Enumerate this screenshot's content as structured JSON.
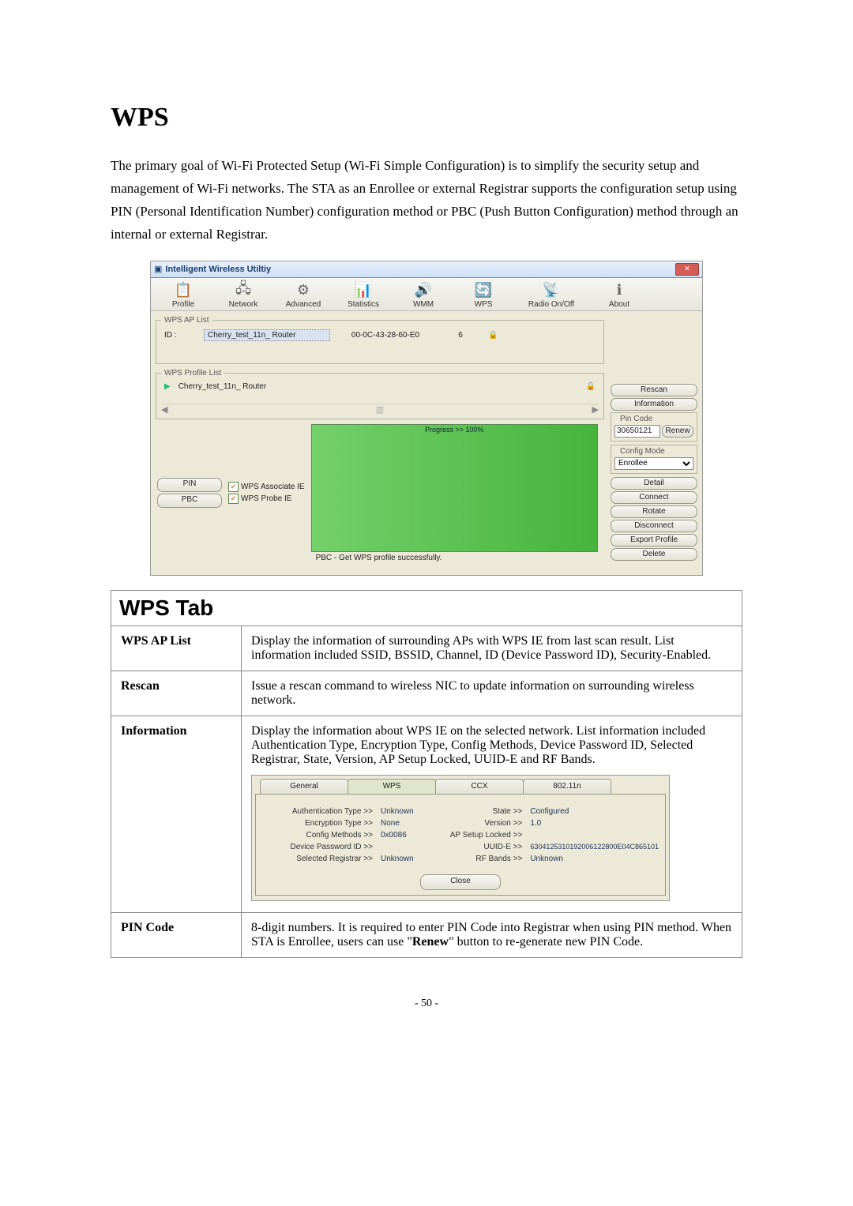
{
  "heading": "WPS",
  "intro": "The primary goal of Wi-Fi Protected Setup (Wi-Fi Simple Configuration) is to simplify the security setup and management of Wi-Fi networks. The STA as an Enrollee or external Registrar supports the configuration setup using PIN (Personal Identification Number) configuration method or PBC (Push Button Configuration) method through an internal or external Registrar.",
  "page_number": "- 50 -",
  "shot1": {
    "title": "Intelligent Wireless Utiltiy",
    "toolbar": {
      "profile": "Profile",
      "network": "Network",
      "advanced": "Advanced",
      "statistics": "Statistics",
      "wmm": "WMM",
      "wps": "WPS",
      "radio": "Radio On/Off",
      "about": "About"
    },
    "ap_list": {
      "legend": "WPS AP List",
      "id_label": "ID :",
      "ssid": "Cherry_test_11n_ Router",
      "bssid": "00-0C-43-28-60-E0",
      "channel": "6"
    },
    "profile_list": {
      "legend": "WPS Profile List",
      "item": "Cherry_test_11n_ Router"
    },
    "side": {
      "rescan": "Rescan",
      "information": "Information",
      "pin_code_label": "Pin Code",
      "pin_code_value": "30650121",
      "renew": "Renew",
      "config_mode_label": "Config Mode",
      "config_mode_value": "Enrollee",
      "detail": "Detail",
      "connect": "Connect",
      "rotate": "Rotate",
      "disconnect": "Disconnect",
      "export_profile": "Export Profile",
      "delete": "Delete"
    },
    "bottom": {
      "pin": "PIN",
      "pbc": "PBC",
      "wps_assoc": "WPS Associate IE",
      "wps_probe": "WPS Probe IE",
      "progress": "Progress >> 100%",
      "status": "PBC - Get WPS profile successfully."
    }
  },
  "table": {
    "title": "WPS Tab",
    "rows": [
      {
        "label": "WPS AP List",
        "text": "Display the information of surrounding APs with WPS IE from last scan result. List information included SSID, BSSID, Channel, ID (Device Password ID), Security-Enabled."
      },
      {
        "label": "Rescan",
        "text": "Issue a rescan command to wireless NIC to update information on surrounding wireless network."
      },
      {
        "label": "Information",
        "text": "Display the information about WPS IE on the selected network. List information included Authentication Type, Encryption Type, Config Methods, Device Password ID, Selected Registrar, State, Version, AP Setup Locked, UUID-E and RF Bands."
      },
      {
        "label": "PIN Code",
        "text_a": "8-digit numbers. It is required to enter PIN Code into Registrar when using PIN method. When STA is Enrollee, users can use \"",
        "text_bold": "Renew",
        "text_b": "\" button to re-generate new PIN Code."
      }
    ]
  },
  "shot2": {
    "tabs": {
      "general": "General",
      "wps": "WPS",
      "ccx": "CCX",
      "dot11n": "802.11n"
    },
    "left": {
      "auth_k": "Authentication Type >>",
      "auth_v": "Unknown",
      "enc_k": "Encryption Type >>",
      "enc_v": "None",
      "cfg_k": "Config Methods >>",
      "cfg_v": "0x0086",
      "dpid_k": "Device Password ID >>",
      "dpid_v": "",
      "sreg_k": "Selected Registrar >>",
      "sreg_v": "Unknown"
    },
    "right": {
      "state_k": "State >>",
      "state_v": "Configured",
      "ver_k": "Version >>",
      "ver_v": "1.0",
      "lock_k": "AP Setup Locked >>",
      "lock_v": "",
      "uuid_k": "UUID-E >>",
      "uuid_v": "6304125310192006122800E04C865101",
      "rf_k": "RF Bands >>",
      "rf_v": "Unknown"
    },
    "close": "Close"
  }
}
